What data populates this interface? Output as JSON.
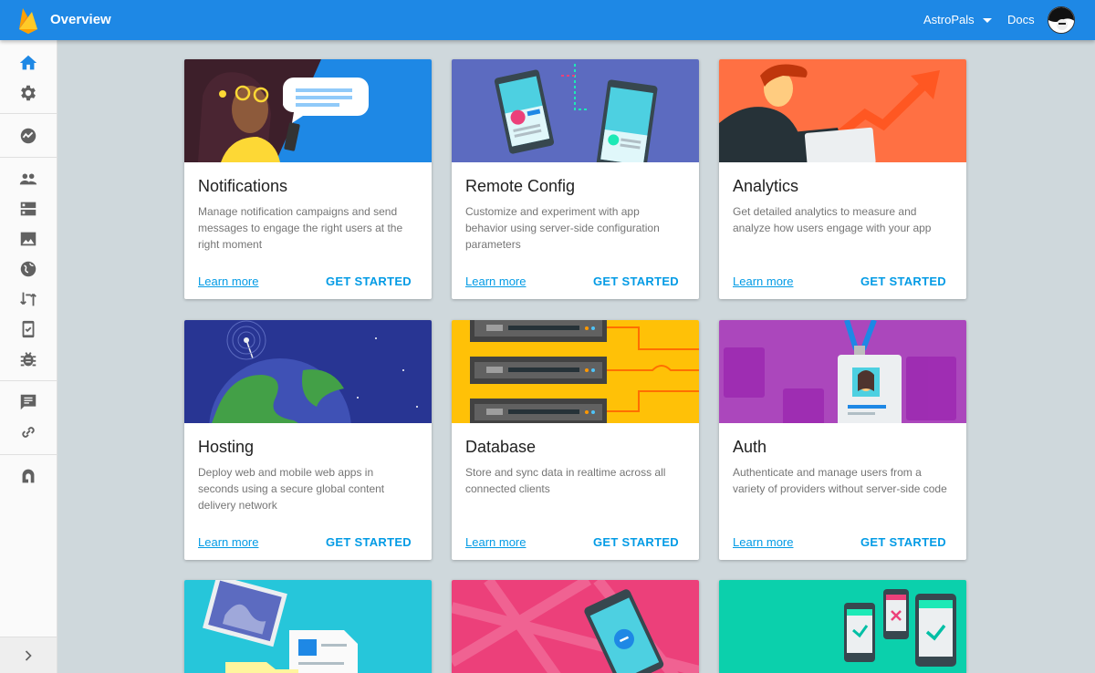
{
  "header": {
    "title": "Overview",
    "project": "AstroPals",
    "docs": "Docs"
  },
  "sidebar": {
    "icons": [
      "home-icon",
      "settings-icon",
      "analytics-icon",
      "users-icon",
      "database-icon",
      "storage-icon",
      "hosting-icon",
      "remote-config-icon",
      "test-lab-icon",
      "crash-icon",
      "notifications-icon",
      "dynamic-links-icon",
      "admob-icon"
    ],
    "collapse_icon": "chevron-right-icon"
  },
  "cards": [
    {
      "title": "Notifications",
      "desc": "Manage notification campaigns and send messages to engage the right users at the right moment",
      "learn": "Learn more",
      "start": "GET STARTED",
      "color": "#1e88e5"
    },
    {
      "title": "Remote Config",
      "desc": "Customize and experiment with app behavior using server-side configuration parameters",
      "learn": "Learn more",
      "start": "GET STARTED",
      "color": "#5c6bc0"
    },
    {
      "title": "Analytics",
      "desc": "Get detailed analytics to measure and analyze how users engage with your app",
      "learn": "Learn more",
      "start": "GET STARTED",
      "color": "#ff7043"
    },
    {
      "title": "Hosting",
      "desc": "Deploy web and mobile web apps in seconds using a secure global content delivery network",
      "learn": "Learn more",
      "start": "GET STARTED",
      "color": "#283593"
    },
    {
      "title": "Database",
      "desc": "Store and sync data in realtime across all connected clients",
      "learn": "Learn more",
      "start": "GET STARTED",
      "color": "#ffc107"
    },
    {
      "title": "Auth",
      "desc": "Authenticate and manage users from a variety of providers without server-side code",
      "learn": "Learn more",
      "start": "GET STARTED",
      "color": "#ab47bc"
    },
    {
      "title": "",
      "desc": "",
      "learn": "",
      "start": "",
      "color": "#26c6da"
    },
    {
      "title": "",
      "desc": "",
      "learn": "",
      "start": "",
      "color": "#ec407a"
    },
    {
      "title": "",
      "desc": "",
      "learn": "",
      "start": "",
      "color": "#1de9b6"
    }
  ],
  "colors": {
    "accent": "#039be5",
    "header": "#1e88e5",
    "background": "#cfd8dc"
  }
}
